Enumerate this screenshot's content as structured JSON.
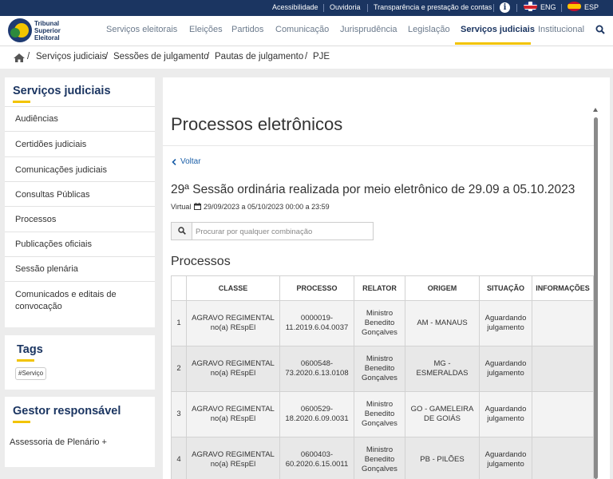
{
  "topbar": {
    "links": [
      "Acessibilidade",
      "Ouvidoria",
      "Transparência e prestação de contas"
    ],
    "info_glyph": "i",
    "lang_en": "ENG",
    "lang_es": "ESP"
  },
  "logo": {
    "line1": "Tribunal",
    "line2": "Superior",
    "line3": "Eleitoral"
  },
  "nav": {
    "items": [
      "Serviços eleitorais",
      "Eleições",
      "Partidos",
      "Comunicação",
      "Jurisprudência",
      "Legislação",
      "Serviços judiciais",
      "Institucional"
    ],
    "active_index": 6
  },
  "breadcrumb": [
    "Serviços judiciais",
    "Sessões de julgamento",
    "Pautas de julgamento",
    "PJE"
  ],
  "sidebar": {
    "title": "Serviços judiciais",
    "items": [
      "Audiências",
      "Certidões judiciais",
      "Comunicações judiciais",
      "Consultas Públicas",
      "Processos",
      "Publicações oficiais",
      "Sessão plenária",
      "Comunicados e editais de convocação"
    ]
  },
  "tags": {
    "title": "Tags",
    "items": [
      "#Serviço"
    ]
  },
  "gestor": {
    "title": "Gestor responsável",
    "name": "Assessoria de Plenário +"
  },
  "main": {
    "title": "Processos eletrônicos",
    "back_label": "Voltar",
    "session_title": "29ª Sessão ordinária realizada por meio eletrônico de 29.09 a 05.10.2023",
    "session_type": "Virtual",
    "session_dates": "29/09/2023 a 05/10/2023 00:00 a 23:59",
    "search_placeholder": "Procurar por qualquer combinação",
    "section_title": "Processos"
  },
  "table": {
    "headers": [
      "",
      "CLASSE",
      "PROCESSO",
      "RELATOR",
      "ORIGEM",
      "SITUAÇÃO",
      "INFORMAÇÕES"
    ],
    "rows": [
      {
        "n": "1",
        "classe": "AGRAVO REGIMENTAL no(a) REspEl",
        "processo": "0000019-11.2019.6.04.0037",
        "relator": "Ministro Benedito Gonçalves",
        "origem": "AM - MANAUS",
        "situacao": "Aguardando julgamento",
        "info": ""
      },
      {
        "n": "2",
        "classe": "AGRAVO REGIMENTAL no(a) REspEl",
        "processo": "0600548-73.2020.6.13.0108",
        "relator": "Ministro Benedito Gonçalves",
        "origem": "MG - ESMERALDAS",
        "situacao": "Aguardando julgamento",
        "info": ""
      },
      {
        "n": "3",
        "classe": "AGRAVO REGIMENTAL no(a) REspEl",
        "processo": "0600529-18.2020.6.09.0031",
        "relator": "Ministro Benedito Gonçalves",
        "origem": "GO - GAMELEIRA DE GOIÁS",
        "situacao": "Aguardando julgamento",
        "info": ""
      },
      {
        "n": "4",
        "classe": "AGRAVO REGIMENTAL no(a) REspEl",
        "processo": "0600403-60.2020.6.15.0011",
        "relator": "Ministro Benedito Gonçalves",
        "origem": "PB - PILÕES",
        "situacao": "Aguardando julgamento",
        "info": ""
      }
    ]
  },
  "colors": {
    "navy": "#1b3561",
    "accent_yellow": "#f2c400"
  },
  "icons": [
    "info-icon",
    "flag-uk-icon",
    "flag-es-icon",
    "search-icon",
    "home-icon",
    "chevron-left-icon",
    "calendar-icon"
  ]
}
